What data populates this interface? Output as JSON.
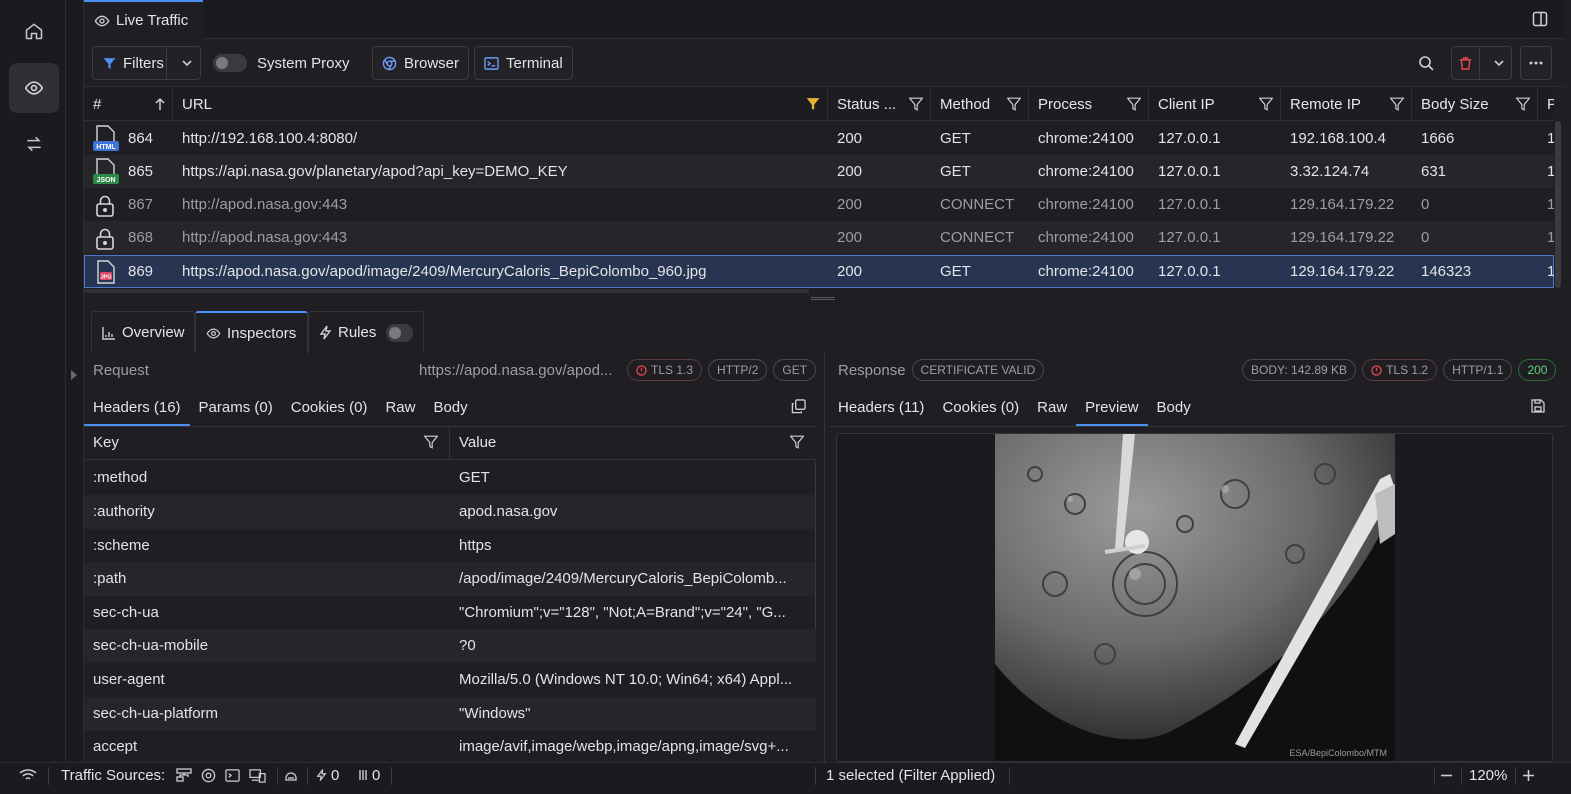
{
  "tab": {
    "title": "Live Traffic"
  },
  "toolbar": {
    "filters": "Filters",
    "system_proxy": "System Proxy",
    "browser": "Browser",
    "terminal": "Terminal"
  },
  "grid": {
    "headers": {
      "num": "#",
      "url": "URL",
      "status": "Status ...",
      "method": "Method",
      "process": "Process",
      "client_ip": "Client IP",
      "remote_ip": "Remote IP",
      "body_size": "Body Size",
      "next": "P"
    },
    "rows": [
      {
        "id": "864",
        "icon": "HTML",
        "url": "http://192.168.100.4:8080/",
        "status": "200",
        "method": "GET",
        "process": "chrome:24100",
        "client_ip": "127.0.0.1",
        "remote_ip": "192.168.100.4",
        "body_size": "1666",
        "next": "1"
      },
      {
        "id": "865",
        "icon": "JSON",
        "url": "https://api.nasa.gov/planetary/apod?api_key=DEMO_KEY",
        "status": "200",
        "method": "GET",
        "process": "chrome:24100",
        "client_ip": "127.0.0.1",
        "remote_ip": "3.32.124.74",
        "body_size": "631",
        "next": "1"
      },
      {
        "id": "867",
        "icon": "lock",
        "url": "http://apod.nasa.gov:443",
        "status": "200",
        "method": "CONNECT",
        "process": "chrome:24100",
        "client_ip": "127.0.0.1",
        "remote_ip": "129.164.179.22",
        "body_size": "0",
        "next": "1"
      },
      {
        "id": "868",
        "icon": "lock",
        "url": "http://apod.nasa.gov:443",
        "status": "200",
        "method": "CONNECT",
        "process": "chrome:24100",
        "client_ip": "127.0.0.1",
        "remote_ip": "129.164.179.22",
        "body_size": "0",
        "next": "1"
      },
      {
        "id": "869",
        "icon": "JPG",
        "url": "https://apod.nasa.gov/apod/image/2409/MercuryCaloris_BepiColombo_960.jpg",
        "status": "200",
        "method": "GET",
        "process": "chrome:24100",
        "client_ip": "127.0.0.1",
        "remote_ip": "129.164.179.22",
        "body_size": "146323",
        "next": "1"
      }
    ]
  },
  "detail_tabs": {
    "overview": "Overview",
    "inspectors": "Inspectors",
    "rules": "Rules"
  },
  "request": {
    "label": "Request",
    "url": "https://apod.nasa.gov/apod...",
    "tls": "TLS 1.3",
    "http": "HTTP/2",
    "method": "GET",
    "tabs": {
      "headers": "Headers (16)",
      "params": "Params (0)",
      "cookies": "Cookies (0)",
      "raw": "Raw",
      "body": "Body"
    },
    "key_header": "Key",
    "value_header": "Value",
    "headers": [
      {
        "k": ":method",
        "v": "GET"
      },
      {
        "k": ":authority",
        "v": "apod.nasa.gov"
      },
      {
        "k": ":scheme",
        "v": "https"
      },
      {
        "k": ":path",
        "v": "/apod/image/2409/MercuryCaloris_BepiColomb..."
      },
      {
        "k": "sec-ch-ua",
        "v": "\"Chromium\";v=\"128\", \"Not;A=Brand\";v=\"24\", \"G..."
      },
      {
        "k": "sec-ch-ua-mobile",
        "v": "?0"
      },
      {
        "k": "user-agent",
        "v": "Mozilla/5.0 (Windows NT 10.0; Win64; x64) Appl..."
      },
      {
        "k": "sec-ch-ua-platform",
        "v": "\"Windows\""
      },
      {
        "k": "accept",
        "v": "image/avif,image/webp,image/apng,image/svg+..."
      }
    ]
  },
  "response": {
    "label": "Response",
    "cert": "CERTIFICATE VALID",
    "body_size": "BODY: 142.89 KB",
    "tls": "TLS 1.2",
    "http": "HTTP/1.1",
    "status": "200",
    "tabs": {
      "headers": "Headers (11)",
      "cookies": "Cookies (0)",
      "raw": "Raw",
      "preview": "Preview",
      "body": "Body"
    },
    "image_credit": "ESA/BepiColombo/MTM"
  },
  "status": {
    "traffic_sources": "Traffic Sources:",
    "rules_count": "0",
    "breakpoints_count": "0",
    "selection": "1 selected (Filter Applied)",
    "zoom": "120%"
  },
  "colors": {
    "accent": "#4d8df7",
    "selection": "#273553",
    "filter_active": "#e8b530",
    "danger": "#e5484d",
    "success": "#5fd07a"
  }
}
